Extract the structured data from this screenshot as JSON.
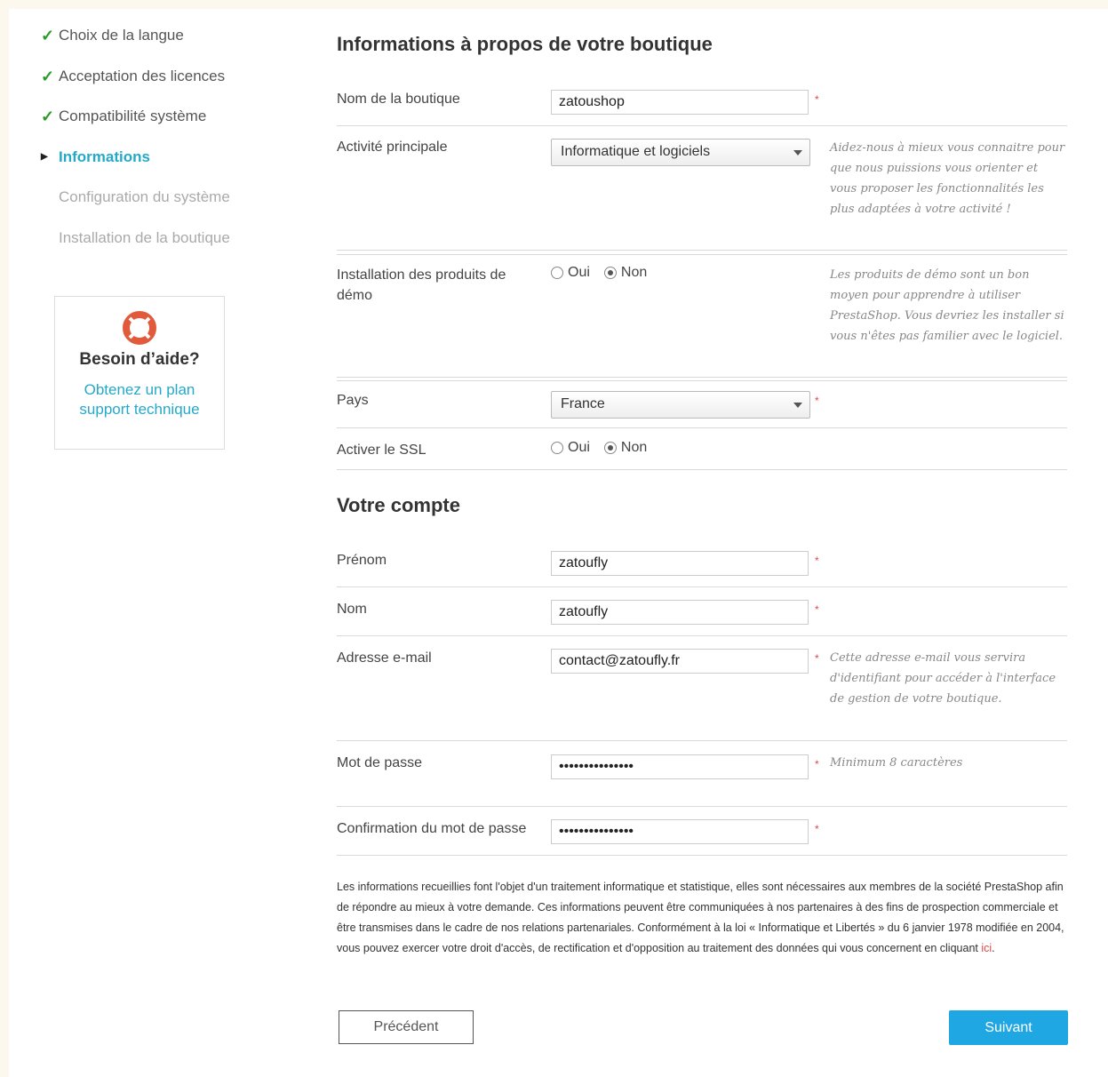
{
  "sidebar": {
    "steps": [
      {
        "label": "Choix de la langue",
        "state": "done"
      },
      {
        "label": "Acceptation des licences",
        "state": "done"
      },
      {
        "label": "Compatibilité système",
        "state": "done"
      },
      {
        "label": "Informations",
        "state": "current"
      },
      {
        "label": "Configuration du système",
        "state": "todo"
      },
      {
        "label": "Installation de la boutique",
        "state": "todo"
      }
    ],
    "help": {
      "title": "Besoin d’aide?",
      "link": "Obtenez un plan support technique"
    }
  },
  "store": {
    "heading": "Informations à propos de votre boutique",
    "name_label": "Nom de la boutique",
    "name_value": "zatoushop",
    "activity_label": "Activité principale",
    "activity_value": "Informatique et logiciels",
    "activity_hint": "Aidez-nous à mieux vous connaitre pour que nous puissions vous orienter et vous proposer les fonctionnalités les plus adaptées à votre activité !",
    "demo_label": "Installation des produits de démo",
    "demo_yes": "Oui",
    "demo_no": "Non",
    "demo_hint": "Les produits de démo sont un bon moyen pour apprendre à utiliser PrestaShop. Vous devriez les installer si vous n'êtes pas familier avec le logiciel.",
    "country_label": "Pays",
    "country_value": "France",
    "ssl_label": "Activer le SSL",
    "ssl_yes": "Oui",
    "ssl_no": "Non"
  },
  "account": {
    "heading": "Votre compte",
    "firstname_label": "Prénom",
    "firstname_value": "zatoufly",
    "lastname_label": "Nom",
    "lastname_value": "zatoufly",
    "email_label": "Adresse e-mail",
    "email_value": "contact@zatoufly.fr",
    "email_hint": "Cette adresse e-mail vous servira d'identifiant pour accéder à l'interface de gestion de votre boutique.",
    "password_label": "Mot de passe",
    "password_value": "•••••••••••••••",
    "password_hint": "Minimum 8 caractères",
    "confirm_label": "Confirmation du mot de passe",
    "confirm_value": "•••••••••••••••",
    "required_mark": "*"
  },
  "legal": {
    "text": "Les informations recueillies font l'objet d'un traitement informatique et statistique, elles sont nécessaires aux membres de la société PrestaShop afin de répondre au mieux à votre demande. Ces informations peuvent être communiquées à nos partenaires à des fins de prospection commerciale et être transmises dans le cadre de nos relations partenariales. Conformément à la loi « Informatique et Libertés » du 6 janvier 1978 modifiée en 2004, vous pouvez exercer votre droit d'accès, de rectification et d'opposition au traitement des données qui vous concernent en cliquant ",
    "link": "ici",
    "end": "."
  },
  "buttons": {
    "previous": "Précédent",
    "next": "Suivant"
  },
  "colors": {
    "accent": "#25a9c9",
    "next_button": "#1fa7e4",
    "check": "#2a9a2a",
    "required": "#e04848"
  }
}
